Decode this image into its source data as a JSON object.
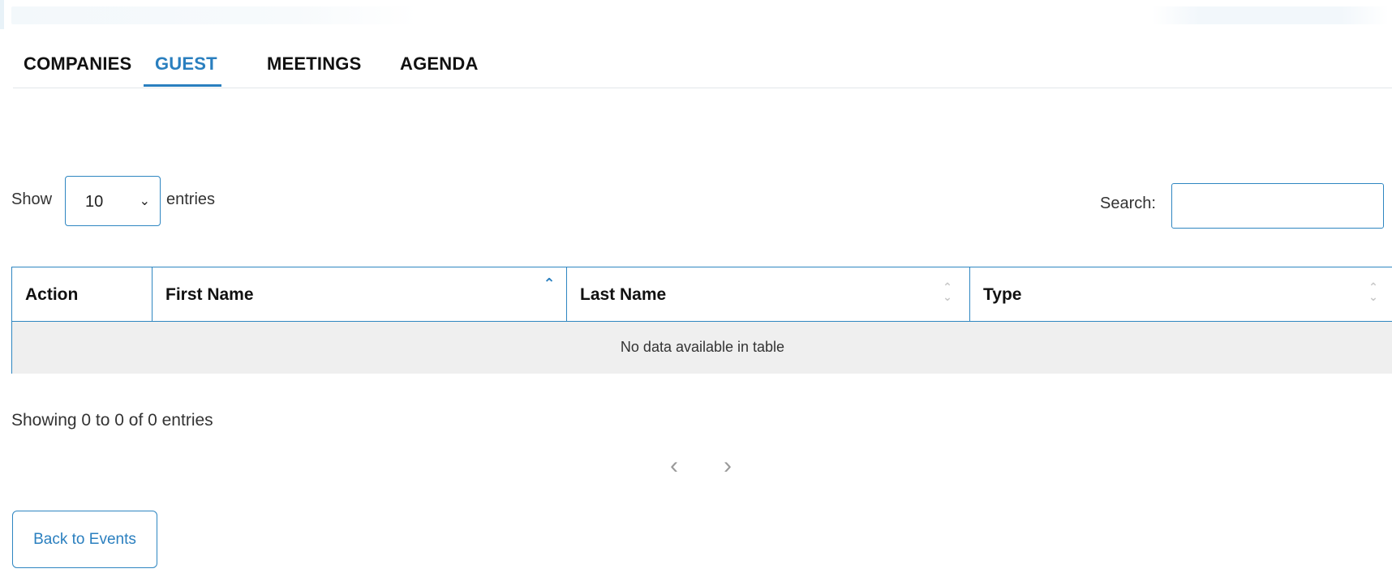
{
  "tabs": [
    {
      "label": "COMPANIES",
      "active": false
    },
    {
      "label": "GUEST",
      "active": true
    },
    {
      "label": "MEETINGS",
      "active": false
    },
    {
      "label": "AGENDA",
      "active": false
    }
  ],
  "length": {
    "show_label": "Show",
    "selected": "10",
    "entries_label": "entries"
  },
  "search": {
    "label": "Search:",
    "value": ""
  },
  "table": {
    "columns": [
      "Action",
      "First Name",
      "Last Name",
      "Type"
    ],
    "sorted_column": "First Name",
    "sort_direction": "ascending",
    "empty_message": "No data available in table",
    "rows": []
  },
  "info": "Showing 0 to 0 of 0 entries",
  "pagination": {
    "prev": "‹",
    "next": "›"
  },
  "back_button": "Back to Events",
  "colors": {
    "accent": "#2a7fbf",
    "border": "#2e86c1",
    "empty_row_bg": "#efefef"
  }
}
